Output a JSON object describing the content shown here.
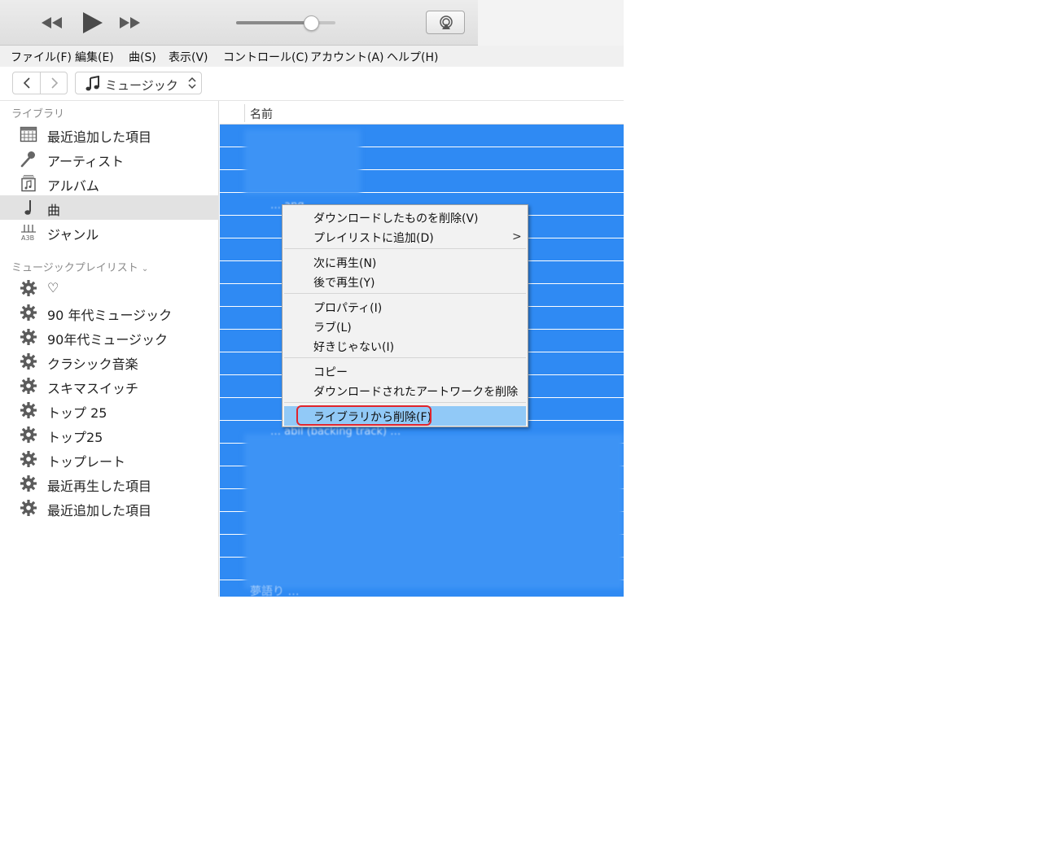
{
  "menu": [
    "ファイル(F)",
    "編集(E)",
    "曲(S)",
    "表示(V)",
    "コントロール(C)",
    "アカウント(A)",
    "ヘルプ(H)"
  ],
  "player": {
    "volume": 0.75
  },
  "nav": {
    "library_selector": "ミュージック"
  },
  "sidebar": {
    "library_title": "ライブラリ",
    "library_items": [
      {
        "label": "最近追加した項目",
        "icon": "calendar-grid-icon"
      },
      {
        "label": "アーティスト",
        "icon": "microphone-icon"
      },
      {
        "label": "アルバム",
        "icon": "album-stack-icon"
      },
      {
        "label": "曲",
        "icon": "music-note-icon",
        "selected": true
      },
      {
        "label": "ジャンル",
        "icon": "genre-icon"
      }
    ],
    "playlists_title": "ミュージックプレイリスト",
    "playlists": [
      {
        "label": "♡",
        "icon": "gear-icon"
      },
      {
        "label": "90 年代ミュージック",
        "icon": "gear-icon"
      },
      {
        "label": "90年代ミュージック",
        "icon": "gear-icon"
      },
      {
        "label": "クラシック音楽",
        "icon": "gear-icon"
      },
      {
        "label": "スキマスイッチ",
        "icon": "gear-icon"
      },
      {
        "label": "トップ 25",
        "icon": "gear-icon"
      },
      {
        "label": "トップ25",
        "icon": "gear-icon"
      },
      {
        "label": "トップレート",
        "icon": "gear-icon"
      },
      {
        "label": "最近再生した項目",
        "icon": "gear-icon"
      },
      {
        "label": "最近追加した項目",
        "icon": "gear-icon"
      }
    ]
  },
  "list": {
    "column_name": "名前",
    "peek_text_1": "… ang…",
    "peek_text_2": "… abil (backing track) …",
    "last_row": "夢語り …"
  },
  "context_menu": {
    "items": [
      "ダウンロードしたものを削除(V)",
      "プレイリストに追加(D)",
      "次に再生(N)",
      "後で再生(Y)",
      "プロパティ(I)",
      "ラブ(L)",
      "好きじゃない(I)",
      "コピー",
      "ダウンロードされたアートワークを削除",
      "ライブラリから削除(F)"
    ],
    "highlighted": "ライブラリから削除(F)",
    "submenu_indicator": ">"
  },
  "colors": {
    "selection_blue": "#2f8af3",
    "highlight_item": "#91c9f7",
    "annotation_red": "#e0242c"
  }
}
